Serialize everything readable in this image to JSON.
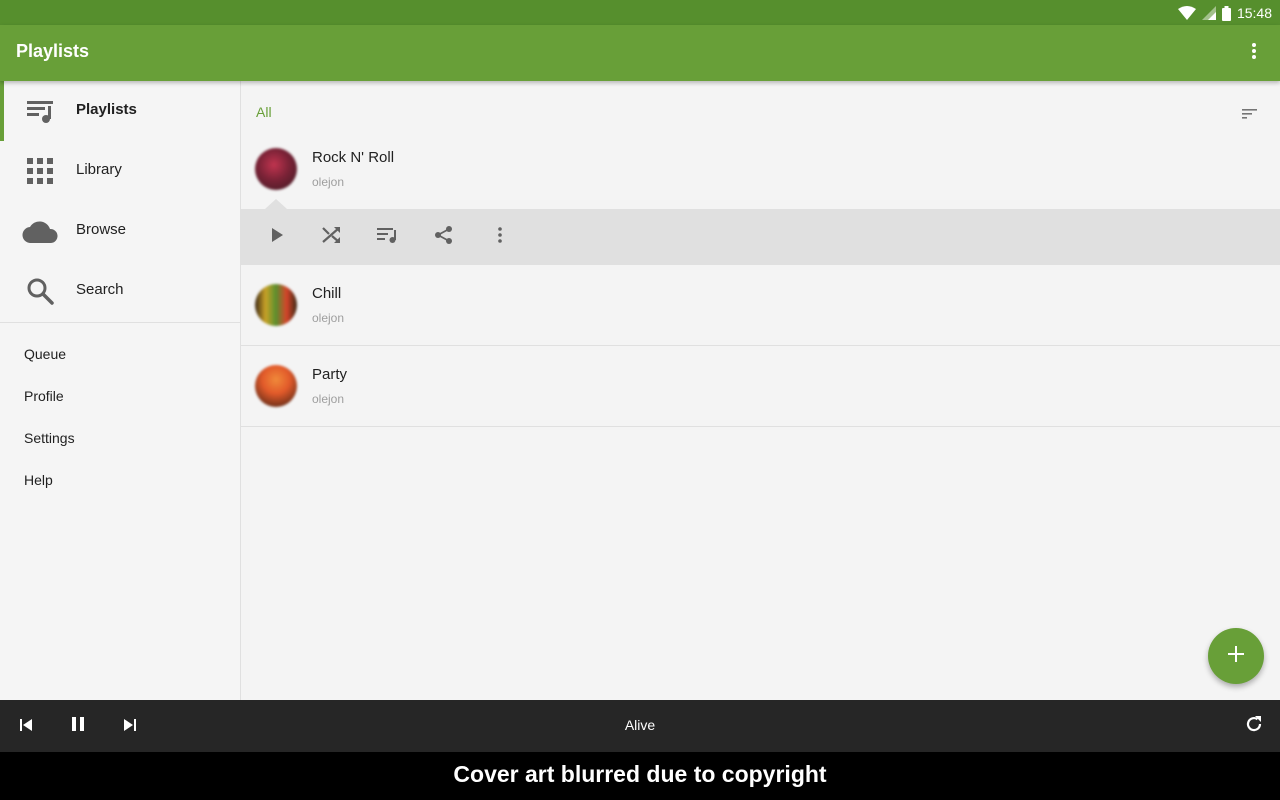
{
  "status_bar": {
    "time": "15:48",
    "icons": [
      "wifi-icon",
      "signal-icon",
      "battery-icon"
    ]
  },
  "app_bar": {
    "title": "Playlists",
    "overflow_icon": "more-vert-icon"
  },
  "sidebar": {
    "primary": [
      {
        "label": "Playlists",
        "icon": "playlist-icon",
        "active": true
      },
      {
        "label": "Library",
        "icon": "grid-icon",
        "active": false
      },
      {
        "label": "Browse",
        "icon": "cloud-icon",
        "active": false
      },
      {
        "label": "Search",
        "icon": "search-icon",
        "active": false
      }
    ],
    "secondary": [
      "Queue",
      "Profile",
      "Settings",
      "Help"
    ]
  },
  "main": {
    "filter": "All",
    "sort_icon": "sort-icon",
    "playlists": [
      {
        "title": "Rock N' Roll",
        "owner": "olejon",
        "art_colors": [
          "#3a1a22",
          "#c0344f"
        ]
      },
      {
        "title": "Chill",
        "owner": "olejon",
        "art_colors": [
          "#c9a227",
          "#5a8f2e"
        ]
      },
      {
        "title": "Party",
        "owner": "olejon",
        "art_colors": [
          "#e25a2a",
          "#3a1d12"
        ]
      }
    ],
    "actions": [
      "play-icon",
      "shuffle-icon",
      "add-to-queue-icon",
      "share-icon",
      "more-vert-icon"
    ],
    "fab_icon": "add-icon"
  },
  "player": {
    "track": "Alive",
    "controls": [
      "skip-previous-icon",
      "pause-icon",
      "skip-next-icon"
    ],
    "refresh_icon": "refresh-icon"
  },
  "caption": "Cover art blurred due to copyright",
  "colors": {
    "accent": "#689f38",
    "status_bar": "#568f2d",
    "player_bg": "#262626"
  }
}
